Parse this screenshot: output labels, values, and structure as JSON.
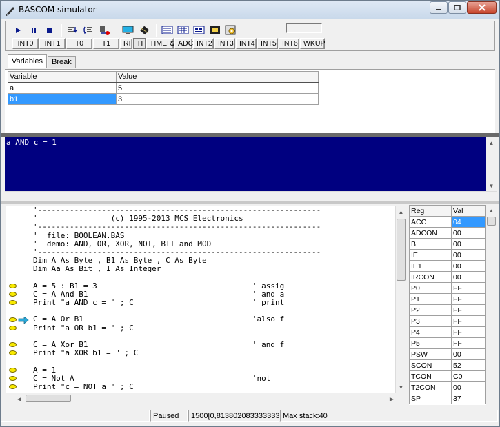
{
  "window": {
    "title": "BASCOM simulator"
  },
  "toolbar": {
    "interrupt_buttons": [
      "INT0",
      "INT1",
      "T0",
      "T1",
      "RI",
      "TI",
      "TIMER2",
      "ADC",
      "INT2",
      "INT3",
      "INT4",
      "INT5",
      "INT6",
      "WKUP"
    ],
    "icons": [
      "run-icon",
      "pause-icon",
      "stop-icon",
      "step-into-icon",
      "step-over-icon",
      "run-to-cursor-icon",
      "terminal-icon",
      "chip-icon",
      "lcd-icon",
      "keyboard-icon",
      "memory-icon",
      "film-icon",
      "settings-icon"
    ]
  },
  "tabs": [
    {
      "label": "Variables",
      "active": true
    },
    {
      "label": "Break",
      "active": false
    }
  ],
  "variables": {
    "headers": [
      "Variable",
      "Value"
    ],
    "rows": [
      {
        "name": "a",
        "value": "5",
        "selected": false
      },
      {
        "name": "b1",
        "value": "3",
        "selected": true
      }
    ]
  },
  "output": {
    "text": "a AND c = 1"
  },
  "source": {
    "lines": [
      "'--------------------------------------------------------------",
      "'                (c) 1995-2013 MCS Electronics",
      "'--------------------------------------------------------------",
      "'  file: BOOLEAN.BAS",
      "'  demo: AND, OR, XOR, NOT, BIT and MOD",
      "'--------------------------------------------------------------",
      "Dim A As Byte , B1 As Byte , C As Byte",
      "Dim Aa As Bit , I As Integer",
      "",
      "A = 5 : B1 = 3                                  ' assig",
      "C = A And B1                                    ' and a",
      "Print \"a AND c = \" ; C                          ' print",
      "",
      "C = A Or B1                                     'also f",
      "Print \"a OR b1 = \" ; C",
      "",
      "C = A Xor B1                                    ' and f",
      "Print \"a XOR b1 = \" ; C",
      "",
      "A = 1",
      "C = Not A                                       'not",
      "Print \"c = NOT a \" ; C"
    ],
    "breakpoint_lines": [
      9,
      10,
      11,
      13,
      14,
      16,
      17,
      19,
      20,
      21
    ],
    "current_line": 13
  },
  "registers": {
    "headers": [
      "Reg",
      "Val"
    ],
    "rows": [
      {
        "name": "ACC",
        "value": "04",
        "selected": true
      },
      {
        "name": "ADCON",
        "value": "00"
      },
      {
        "name": "B",
        "value": "00"
      },
      {
        "name": "IE",
        "value": "00"
      },
      {
        "name": "IE1",
        "value": "00"
      },
      {
        "name": "IRCON",
        "value": "00"
      },
      {
        "name": "P0",
        "value": "FF"
      },
      {
        "name": "P1",
        "value": "FF"
      },
      {
        "name": "P2",
        "value": "FF"
      },
      {
        "name": "P3",
        "value": "FF"
      },
      {
        "name": "P4",
        "value": "FF"
      },
      {
        "name": "P5",
        "value": "FF"
      },
      {
        "name": "PSW",
        "value": "00"
      },
      {
        "name": "SCON",
        "value": "52"
      },
      {
        "name": "TCON",
        "value": "C0"
      },
      {
        "name": "T2CON",
        "value": "00"
      },
      {
        "name": "SP",
        "value": "37"
      }
    ]
  },
  "status": {
    "state": "Paused",
    "position": "1500[0,813802083333333m",
    "stack": "Max stack:40"
  },
  "colors": {
    "selection": "#3399ff",
    "output_bg": "#000080",
    "breakpoint": "#f7e900",
    "exec_arrow": "#2aa8d8"
  }
}
